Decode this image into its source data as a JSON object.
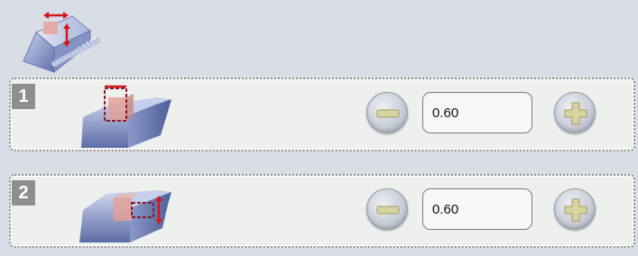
{
  "rows": [
    {
      "number": "1",
      "value": "0.60",
      "icon": "profile-height-icon"
    },
    {
      "number": "2",
      "value": "0.60",
      "icon": "profile-depth-icon"
    }
  ],
  "header": {
    "icon": "profile-size-icon"
  },
  "buttons": {
    "decrease_icon": "minus-icon",
    "increase_icon": "plus-icon"
  },
  "colors": {
    "background": "#d9dde6",
    "panel": "#eef0ee",
    "badge": "#8e8e8e",
    "accent_red": "#d01818",
    "button_symbol": "#d8d4a0"
  }
}
